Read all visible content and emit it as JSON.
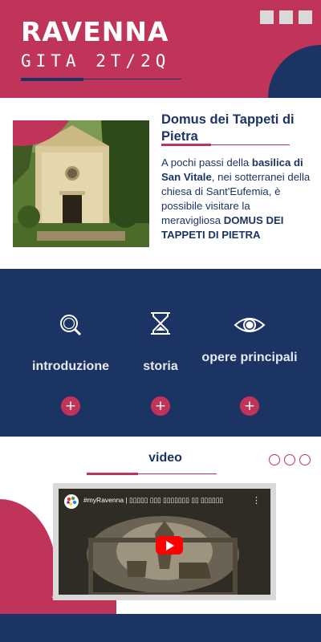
{
  "header": {
    "title": "RAVENNA",
    "subtitle": "GITA 2T/2Q",
    "window_buttons": [
      "square-icon",
      "square-icon",
      "square-icon"
    ]
  },
  "article": {
    "title": "Domus dei Tappeti di Pietra",
    "text_parts": [
      "A pochi passi della ",
      "basilica di San Vitale",
      ", nei sotterranei della chiesa di Sant'Eufemia, è possibile visitare la meravigliosa ",
      "DOMUS DEI TAPPETI DI PIETRA"
    ],
    "image_icon": "church-photo"
  },
  "features": [
    {
      "label": "introduzione",
      "icon": "search-icon",
      "action": "+"
    },
    {
      "label": "storia",
      "icon": "hourglass-icon",
      "action": "+"
    },
    {
      "label": "opere principali",
      "icon": "eye-icon",
      "action": "+"
    }
  ],
  "video": {
    "title": "video",
    "embed_title": "#myRavenna | ▯▯▯▯▯ ▯▯▯ ▯▯▯▯▯▯▯ ▯▯ ▯▯▯▯▯▯",
    "menu": "⋮",
    "play_icon": "youtube-play-icon"
  },
  "colors": {
    "accent": "#c0345a",
    "navy": "#1c3464",
    "light_gray": "#d9d9d9"
  }
}
